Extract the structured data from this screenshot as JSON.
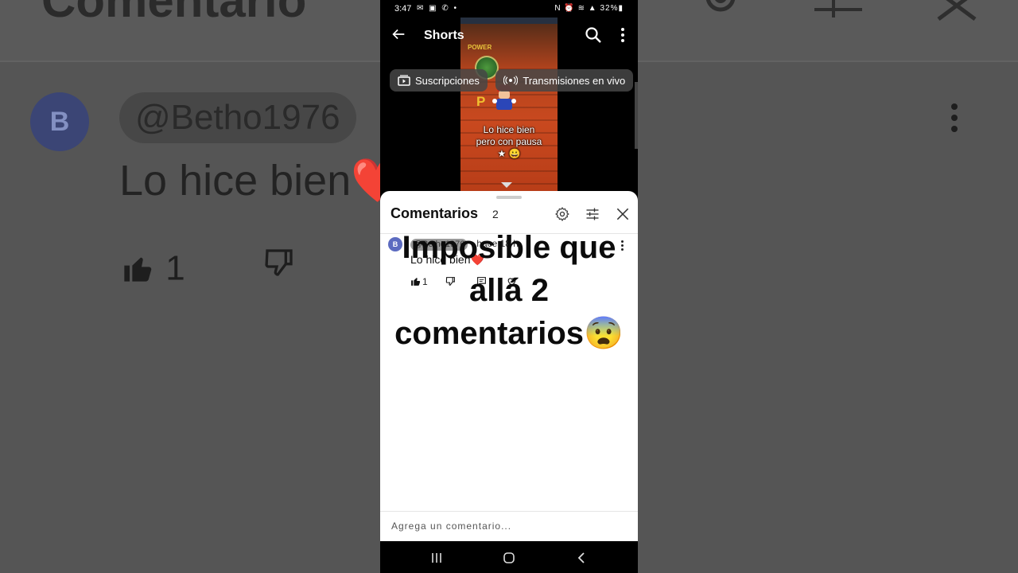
{
  "background": {
    "title": "Comentario",
    "avatar_letter": "B",
    "handle": "@Betho1976",
    "comment": "Lo hice bien❤️",
    "likes": "1"
  },
  "status_bar": {
    "time": "3:47",
    "left_icons": "✉ ▣ ✆ •",
    "right_icons": "N ⏰ ≋ ▲ 32%▮",
    "battery": "32%"
  },
  "top_bar": {
    "title": "Shorts"
  },
  "chips": [
    {
      "label": "Suscripciones",
      "icon": "subscriptions-icon"
    },
    {
      "label": "Transmisiones en vivo",
      "icon": "live-icon"
    }
  ],
  "video": {
    "caption_line1": "Lo hice bien",
    "caption_line2": "pero con pausa",
    "caption_emoji": "★ 😀",
    "game_text": "POWER",
    "letter": "P"
  },
  "comments_sheet": {
    "title": "Comentarios",
    "count": "2",
    "comment": {
      "avatar_letter": "B",
      "handle": "@Betho1976",
      "time": "• hace 18 h",
      "text": "Lo hice bien❤️",
      "likes": "1"
    },
    "input_placeholder": "Agrega un comentario..."
  },
  "overlay": {
    "line1": "Imposible que",
    "line2": "allá 2",
    "line3": "comentarios😨"
  },
  "colors": {
    "accent_avatar": "#5c6bc0",
    "sheet_bg": "#ffffff",
    "phone_bg": "#000000",
    "background_blur": "#555555"
  }
}
